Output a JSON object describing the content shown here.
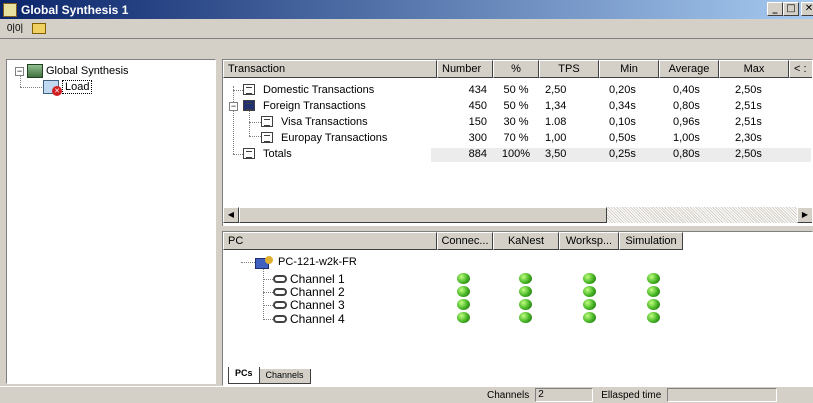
{
  "window": {
    "title": "Global Synthesis 1"
  },
  "toolbar": {
    "btn1": "0|0|",
    "btn2": "folder-icon"
  },
  "tree": {
    "root_label": "Global Synthesis",
    "child_label": "Load"
  },
  "transactions": {
    "headers": [
      "Transaction",
      "Number",
      "%",
      "TPS",
      "Min",
      "Average",
      "Max",
      "< :"
    ],
    "rows": [
      {
        "name": "Domestic Transactions",
        "number": "434",
        "pct": "50 %",
        "tps": "2,50",
        "min": "0,20s",
        "avg": "0,40s",
        "max": "2,50s"
      },
      {
        "name": "Foreign Transactions",
        "number": "450",
        "pct": "50 %",
        "tps": "1,34",
        "min": "0,34s",
        "avg": "0,80s",
        "max": "2,51s"
      },
      {
        "name": "Visa Transactions",
        "number": "150",
        "pct": "30 %",
        "tps": "1.08",
        "min": "0,10s",
        "avg": "0,96s",
        "max": "2,51s"
      },
      {
        "name": "Europay Transactions",
        "number": "300",
        "pct": "70 %",
        "tps": "1,00",
        "min": "0,50s",
        "avg": "1,00s",
        "max": "2,30s"
      },
      {
        "name": "Totals",
        "number": "884",
        "pct": "100%",
        "tps": "3,50",
        "min": "0,25s",
        "avg": "0,80s",
        "max": "2,50s"
      }
    ]
  },
  "pcs": {
    "headers": [
      "PC",
      "Connec...",
      "KaNest",
      "Worksp...",
      "Simulation"
    ],
    "pc_name": "PC-121-w2k-FR",
    "channels": [
      "Channel 1",
      "Channel 2",
      "Channel 3",
      "Channel 4"
    ],
    "status_color": "#40b020"
  },
  "tabs": [
    "PCs",
    "Channels"
  ],
  "status": {
    "channels_label": "Channels",
    "channels_value": "2",
    "elapsed_label": "Ellasped time"
  }
}
